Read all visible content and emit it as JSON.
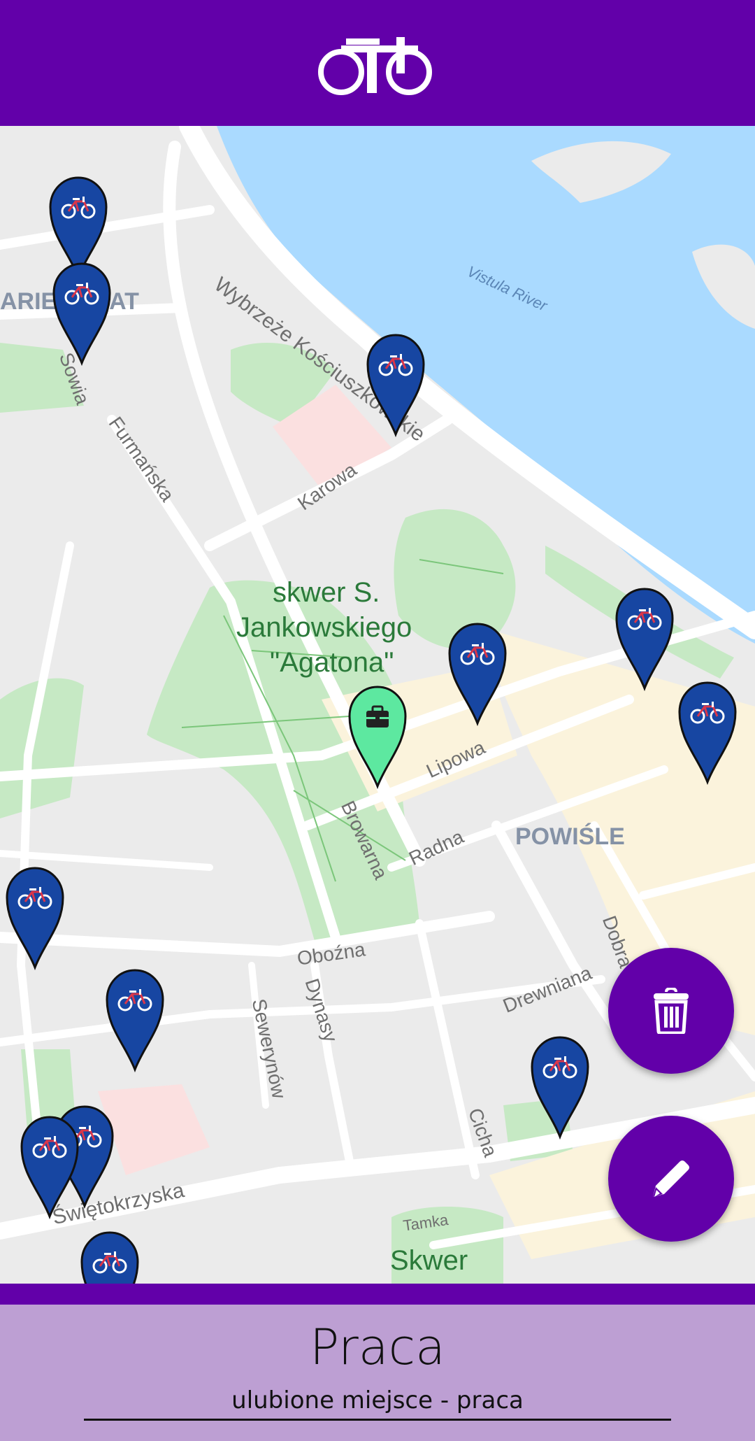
{
  "header": {
    "icon": "bicycle-icon",
    "color": "#6200a9"
  },
  "map": {
    "labels": {
      "wybrzeze": "Wybrzeże Kościuszkowskie",
      "vistula": "Vistula River",
      "ariestat": "ARIEN STAT",
      "sowia": "Sowia",
      "furmanska": "Furmańska",
      "karowa": "Karowa",
      "skwer_line1": "skwer S.",
      "skwer_line2": "Jankowskiego",
      "skwer_line3": "\"Agatona\"",
      "lipowa": "Lipowa",
      "browarna": "Browarna",
      "radna": "Radna",
      "powisle": "POWIŚLE",
      "dobra": "Dobra",
      "drewniana": "Drewniana",
      "obozna": "Oboźna",
      "dynasy": "Dynasy",
      "sewerynow": "Sewerynów",
      "cicha": "Cicha",
      "swietokrzyska": "Świętokrzyska",
      "tamka": "Tamka",
      "skwer_bottom": "Skwer"
    },
    "markers": {
      "bike": {
        "icon": "bicycle-icon",
        "color": "#1746a2"
      },
      "work": {
        "icon": "briefcase-icon",
        "color": "#5de8a0"
      }
    }
  },
  "actions": {
    "delete": {
      "icon": "trash-icon"
    },
    "edit": {
      "icon": "pencil-icon"
    }
  },
  "footer": {
    "title": "Praca",
    "subtitle": "ulubione miejsce - praca"
  }
}
